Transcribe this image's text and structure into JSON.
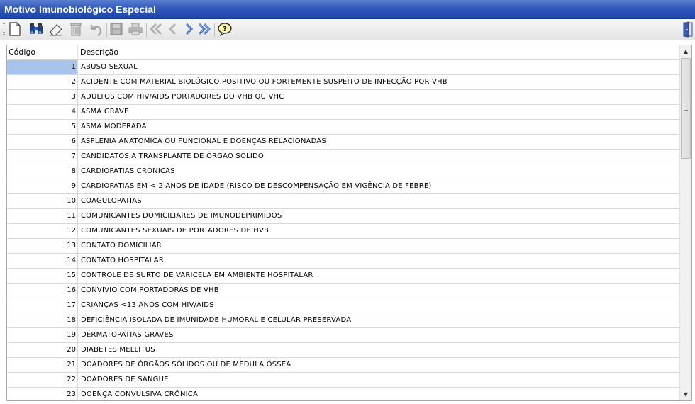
{
  "window": {
    "title": "Motivo Imunobiológico Especial"
  },
  "toolbar": {
    "buttons": [
      {
        "icon": "new-document-icon",
        "enabled": true
      },
      {
        "icon": "binoculars-search-icon",
        "enabled": true
      },
      {
        "icon": "eraser-icon",
        "enabled": true
      },
      {
        "icon": "trash-icon",
        "enabled": false
      },
      {
        "icon": "undo-icon",
        "enabled": false
      },
      {
        "icon": "save-icon",
        "enabled": false
      },
      {
        "icon": "print-icon",
        "enabled": false
      },
      {
        "icon": "first-record-icon",
        "enabled": false
      },
      {
        "icon": "previous-record-icon",
        "enabled": false
      },
      {
        "icon": "next-record-icon",
        "enabled": true
      },
      {
        "icon": "last-record-icon",
        "enabled": true
      },
      {
        "icon": "help-icon",
        "enabled": true
      }
    ],
    "exit_icon": "exit-door-icon"
  },
  "grid": {
    "columns": {
      "code": "Código",
      "description": "Descrição"
    },
    "selected_index": 0,
    "rows": [
      {
        "code": "1",
        "description": "ABUSO SEXUAL"
      },
      {
        "code": "2",
        "description": "ACIDENTE COM MATERIAL BIOLÓGICO POSITIVO OU FORTEMENTE SUSPEITO DE INFECÇÃO POR VHB"
      },
      {
        "code": "3",
        "description": "ADULTOS COM HIV/AIDS PORTADORES DO VHB OU VHC"
      },
      {
        "code": "4",
        "description": "ASMA GRAVE"
      },
      {
        "code": "5",
        "description": "ASMA MODERADA"
      },
      {
        "code": "6",
        "description": "ASPLENIA ANATOMICA OU FUNCIONAL E DOENÇAS RELACIONADAS"
      },
      {
        "code": "7",
        "description": "CANDIDATOS A TRANSPLANTE DE ÓRGÃO SÓLIDO"
      },
      {
        "code": "8",
        "description": "CARDIOPATIAS CRÔNICAS"
      },
      {
        "code": "9",
        "description": "CARDIOPATIAS EM < 2 ANOS DE IDADE (RISCO DE DESCOMPENSAÇÃO EM VIGÊNCIA DE FEBRE)"
      },
      {
        "code": "10",
        "description": "COAGULOPATIAS"
      },
      {
        "code": "11",
        "description": "COMUNICANTES DOMICILIARES DE IMUNODEPRIMIDOS"
      },
      {
        "code": "12",
        "description": "COMUNICANTES SEXUAIS DE PORTADORES DE HVB"
      },
      {
        "code": "13",
        "description": "CONTATO DOMICILIAR"
      },
      {
        "code": "14",
        "description": "CONTATO HOSPITALAR"
      },
      {
        "code": "15",
        "description": "CONTROLE DE SURTO DE VARICELA EM AMBIENTE HOSPITALAR"
      },
      {
        "code": "16",
        "description": "CONVÍVIO COM PORTADORAS DE VHB"
      },
      {
        "code": "17",
        "description": "CRIANÇAS <13 ANOS COM HIV/AIDS"
      },
      {
        "code": "18",
        "description": "DEFICIÊNCIA ISOLADA DE IMUNIDADE HUMORAL E CELULAR PRESERVADA"
      },
      {
        "code": "19",
        "description": "DERMATOPATIAS GRAVES"
      },
      {
        "code": "20",
        "description": "DIABETES MELLITUS"
      },
      {
        "code": "21",
        "description": "DOADORES DE ÓRGÃOS SÓLIDOS OU DE MEDULA ÓSSEA"
      },
      {
        "code": "22",
        "description": "DOADORES DE SANGUE"
      },
      {
        "code": "23",
        "description": "DOENÇA CONVULSIVA CRÔNICA"
      }
    ]
  },
  "colors": {
    "titlebar": "#2f58bb",
    "selection": "#a9c4ea"
  }
}
